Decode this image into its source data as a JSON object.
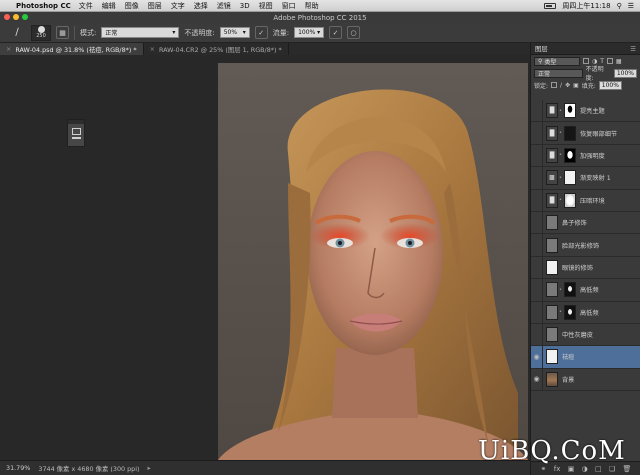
{
  "menubar": {
    "app_name": "Photoshop CC",
    "items": [
      "文件",
      "编辑",
      "图像",
      "图层",
      "文字",
      "选择",
      "滤镜",
      "3D",
      "视图",
      "窗口",
      "帮助"
    ],
    "clock": "周四上午11:18"
  },
  "window": {
    "title": "Adobe Photoshop CC 2015"
  },
  "options_bar": {
    "brush_size": "250",
    "mode_label": "模式:",
    "mode_value": "正常",
    "opacity_label": "不透明度:",
    "opacity_value": "50%",
    "flow_label": "流量:",
    "flow_value": "100%"
  },
  "tabs": [
    {
      "label": "RAW-04.psd @ 31.8% (祛痘, RGB/8*) *",
      "active": true
    },
    {
      "label": "RAW-04.CR2 @ 25% (图层 1, RGB/8*) *",
      "active": false
    }
  ],
  "status": {
    "zoom": "31.79%",
    "doc_info": "3744 像素 x 4680 像素 (300 ppi)"
  },
  "layers_panel": {
    "title": "图层",
    "filter_value": "类型",
    "blend_mode": "正常",
    "opacity_label": "不透明度:",
    "opacity_value": "100%",
    "lock_label": "锁定:",
    "fill_label": "填充:",
    "fill_value": "100%",
    "layers": [
      {
        "name": "提亮主题",
        "visible": false,
        "selected": false
      },
      {
        "name": "恢复眼部细节",
        "visible": false,
        "selected": false
      },
      {
        "name": "加强明度",
        "visible": false,
        "selected": false
      },
      {
        "name": "渐变映射 1",
        "visible": false,
        "selected": false
      },
      {
        "name": "压暗环境",
        "visible": false,
        "selected": false
      },
      {
        "name": "鼻子修饰",
        "visible": false,
        "selected": false
      },
      {
        "name": "脸部光影修饰",
        "visible": false,
        "selected": false
      },
      {
        "name": "眼镜的修饰",
        "visible": false,
        "selected": false
      },
      {
        "name": "高低频",
        "visible": false,
        "selected": false
      },
      {
        "name": "高低频",
        "visible": false,
        "selected": false
      },
      {
        "name": "中性灰磨皮",
        "visible": false,
        "selected": false
      },
      {
        "name": "祛痘",
        "visible": true,
        "selected": true
      },
      {
        "name": "背景",
        "visible": true,
        "selected": false
      }
    ]
  },
  "watermark": {
    "text": "UiBQ.CoM"
  }
}
